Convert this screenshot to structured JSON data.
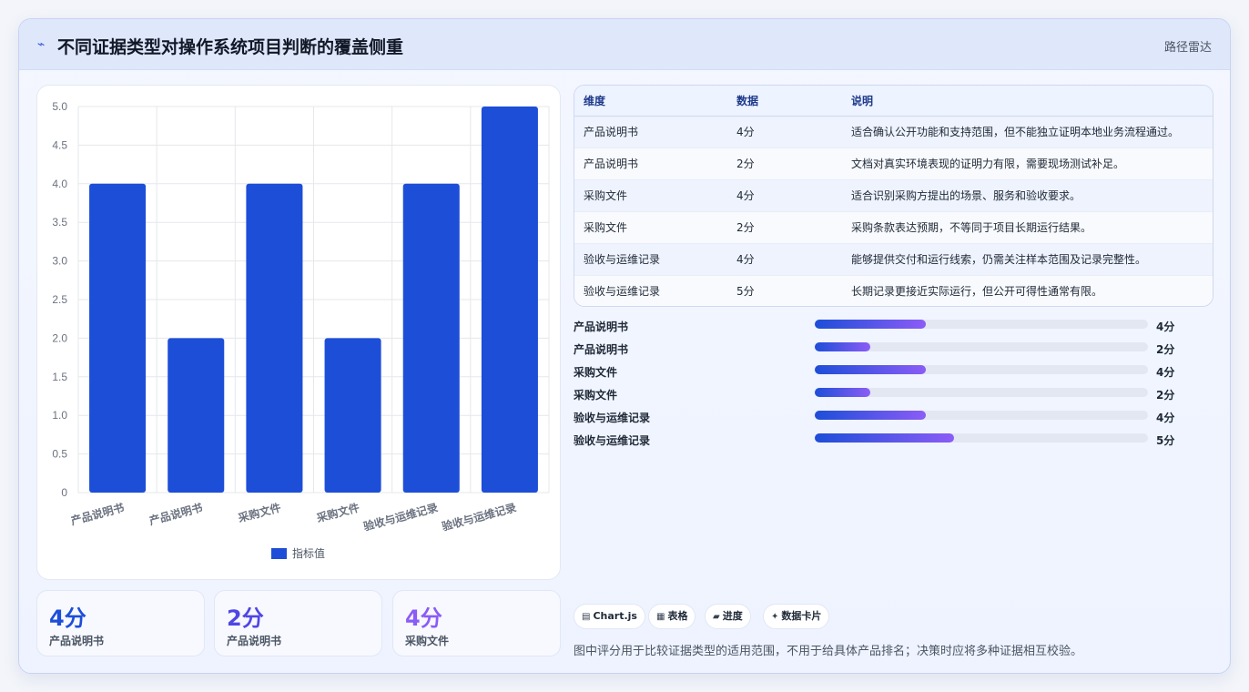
{
  "header": {
    "icon": "line-chart-icon",
    "title": "不同证据类型对操作系统项目判断的覆盖侧重",
    "right_label": "路径雷达"
  },
  "chart_data": {
    "type": "bar",
    "categories": [
      "产品说明书",
      "产品说明书",
      "采购文件",
      "采购文件",
      "验收与运维记录",
      "验收与运维记录"
    ],
    "series": [
      {
        "name": "指标值",
        "values": [
          4,
          2,
          4,
          2,
          4,
          5
        ],
        "color": "#1d4ed8"
      }
    ],
    "ylim": [
      0,
      5
    ],
    "yticks": [
      "0",
      "0.5",
      "1.0",
      "1.5",
      "2.0",
      "2.5",
      "3.0",
      "3.5",
      "4.0",
      "4.5",
      "5.0"
    ],
    "grid": true,
    "legend_position": "bottom"
  },
  "table": {
    "headers": [
      "维度",
      "数据",
      "说明"
    ],
    "rows": [
      [
        "产品说明书",
        "4分",
        "适合确认公开功能和支持范围，但不能独立证明本地业务流程通过。"
      ],
      [
        "产品说明书",
        "2分",
        "文档对真实环境表现的证明力有限，需要现场测试补足。"
      ],
      [
        "采购文件",
        "4分",
        "适合识别采购方提出的场景、服务和验收要求。"
      ],
      [
        "采购文件",
        "2分",
        "采购条款表达预期，不等同于项目长期运行结果。"
      ],
      [
        "验收与运维记录",
        "4分",
        "能够提供交付和运行线索，仍需关注样本范围及记录完整性。"
      ],
      [
        "验收与运维记录",
        "5分",
        "长期记录更接近实际运行，但公开可得性通常有限。"
      ]
    ]
  },
  "progress": [
    {
      "label": "产品说明书",
      "value_text": "4分",
      "fraction": 0.333
    },
    {
      "label": "产品说明书",
      "value_text": "2分",
      "fraction": 0.167
    },
    {
      "label": "采购文件",
      "value_text": "4分",
      "fraction": 0.333
    },
    {
      "label": "采购文件",
      "value_text": "2分",
      "fraction": 0.167
    },
    {
      "label": "验收与运维记录",
      "value_text": "4分",
      "fraction": 0.333
    },
    {
      "label": "验收与运维记录",
      "value_text": "5分",
      "fraction": 0.417
    }
  ],
  "stats": [
    {
      "value": "4分",
      "label": "产品说明书",
      "color": "#1d4ed8"
    },
    {
      "value": "2分",
      "label": "产品说明书",
      "color": "#4f46e5"
    },
    {
      "value": "4分",
      "label": "采购文件",
      "color": "#8b5cf6"
    }
  ],
  "chips": [
    {
      "icon": "chart-icon",
      "glyph": "▤",
      "label": "Chart.js"
    },
    {
      "icon": "table-icon",
      "glyph": "▦",
      "label": "表格"
    },
    {
      "icon": "progress-icon",
      "glyph": "▰",
      "label": "进度"
    },
    {
      "icon": "card-icon",
      "glyph": "✦",
      "label": "数据卡片"
    }
  ],
  "footnote": "图中评分用于比较证据类型的适用范围，不用于给具体产品排名；决策时应将多种证据相互校验。"
}
